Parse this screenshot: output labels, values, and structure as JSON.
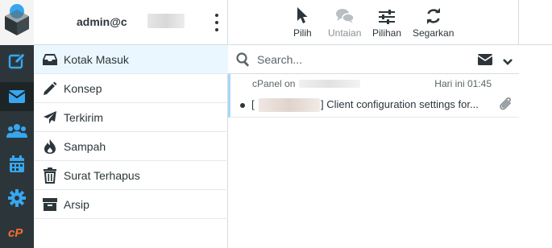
{
  "user": {
    "name": "admin@c"
  },
  "toolbar": {
    "buttons": [
      {
        "label": "Pilih",
        "icon": "pointer-icon",
        "enabled": true
      },
      {
        "label": "Untaian",
        "icon": "comments-icon",
        "enabled": false
      },
      {
        "label": "Pilihan",
        "icon": "sliders-icon",
        "enabled": true
      },
      {
        "label": "Segarkan",
        "icon": "refresh-icon",
        "enabled": true
      }
    ]
  },
  "folders": [
    {
      "label": "Kotak Masuk",
      "icon": "inbox-icon",
      "active": true
    },
    {
      "label": "Konsep",
      "icon": "pencil-icon"
    },
    {
      "label": "Terkirim",
      "icon": "send-icon"
    },
    {
      "label": "Sampah",
      "icon": "fire-icon"
    },
    {
      "label": "Surat Terhapus",
      "icon": "trash-icon"
    },
    {
      "label": "Arsip",
      "icon": "archive-icon"
    }
  ],
  "search": {
    "placeholder": "Search..."
  },
  "messages": [
    {
      "from": "cPanel on",
      "date": "Hari ini 01:45",
      "subject_prefix": "[",
      "subject": "] Client configuration settings for...",
      "has_attachment": true,
      "unread": true
    }
  ],
  "colors": {
    "rail": "#2c363a",
    "rail_icons": "#37a6f0",
    "active_folder_bg": "#ebf7ff",
    "cpanel_orange": "#ff6c2c",
    "message_accent": "#a6d8f5"
  }
}
